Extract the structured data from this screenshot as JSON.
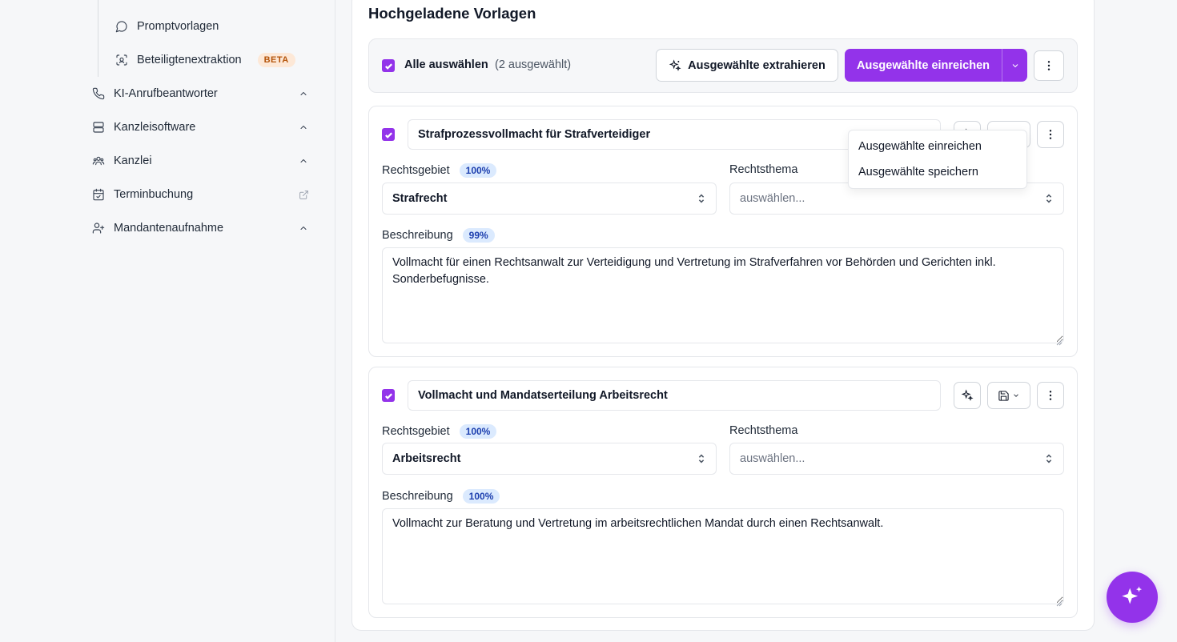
{
  "sidebar": {
    "sub_items": [
      {
        "label": "Promptvorlagen",
        "icon": "chat-bubble-icon"
      },
      {
        "label": "Beteiligtenextraktion",
        "icon": "scan-face-icon",
        "badge": "BETA"
      }
    ],
    "items": [
      {
        "label": "KI-Anrufbeantworter",
        "icon": "phone-icon"
      },
      {
        "label": "Kanzleisoftware",
        "icon": "server-icon"
      },
      {
        "label": "Kanzlei",
        "icon": "team-icon"
      },
      {
        "label": "Terminbuchung",
        "icon": "calendar-check-icon"
      },
      {
        "label": "Mandantenaufnahme",
        "icon": "user-plus-icon"
      }
    ]
  },
  "main": {
    "title": "Hochgeladene Vorlagen",
    "toolbar": {
      "select_all_label": "Alle auswählen",
      "selected_count": "(2 ausgewählt)",
      "extract_label": "Ausgewählte extrahieren",
      "submit_label": "Ausgewählte einreichen"
    },
    "dropdown": {
      "items": [
        "Ausgewählte einreichen",
        "Ausgewählte speichern"
      ]
    },
    "cards": [
      {
        "title": "Strafprozessvollmacht für Strafverteidiger",
        "area_label": "Rechtsgebiet",
        "area_confidence": "100%",
        "area_value": "Strafrecht",
        "topic_label": "Rechtsthema",
        "topic_placeholder": "auswählen...",
        "desc_label": "Beschreibung",
        "desc_confidence": "99%",
        "description": "Vollmacht für einen Rechtsanwalt zur Verteidigung und Vertretung im Strafverfahren vor Behörden und Gerichten inkl. Sonderbefugnisse."
      },
      {
        "title": "Vollmacht und Mandatserteilung Arbeitsrecht",
        "area_label": "Rechtsgebiet",
        "area_confidence": "100%",
        "area_value": "Arbeitsrecht",
        "topic_label": "Rechtsthema",
        "topic_placeholder": "auswählen...",
        "desc_label": "Beschreibung",
        "desc_confidence": "100%",
        "description": "Vollmacht zur Beratung und Vertretung im arbeitsrechtlichen Mandat durch einen Rechtsanwalt."
      }
    ]
  },
  "colors": {
    "accent": "#9333ea",
    "beta_bg": "#fde8d7",
    "beta_text": "#b45309",
    "confidence_bg": "#dbeafe",
    "confidence_text": "#1e40af"
  }
}
